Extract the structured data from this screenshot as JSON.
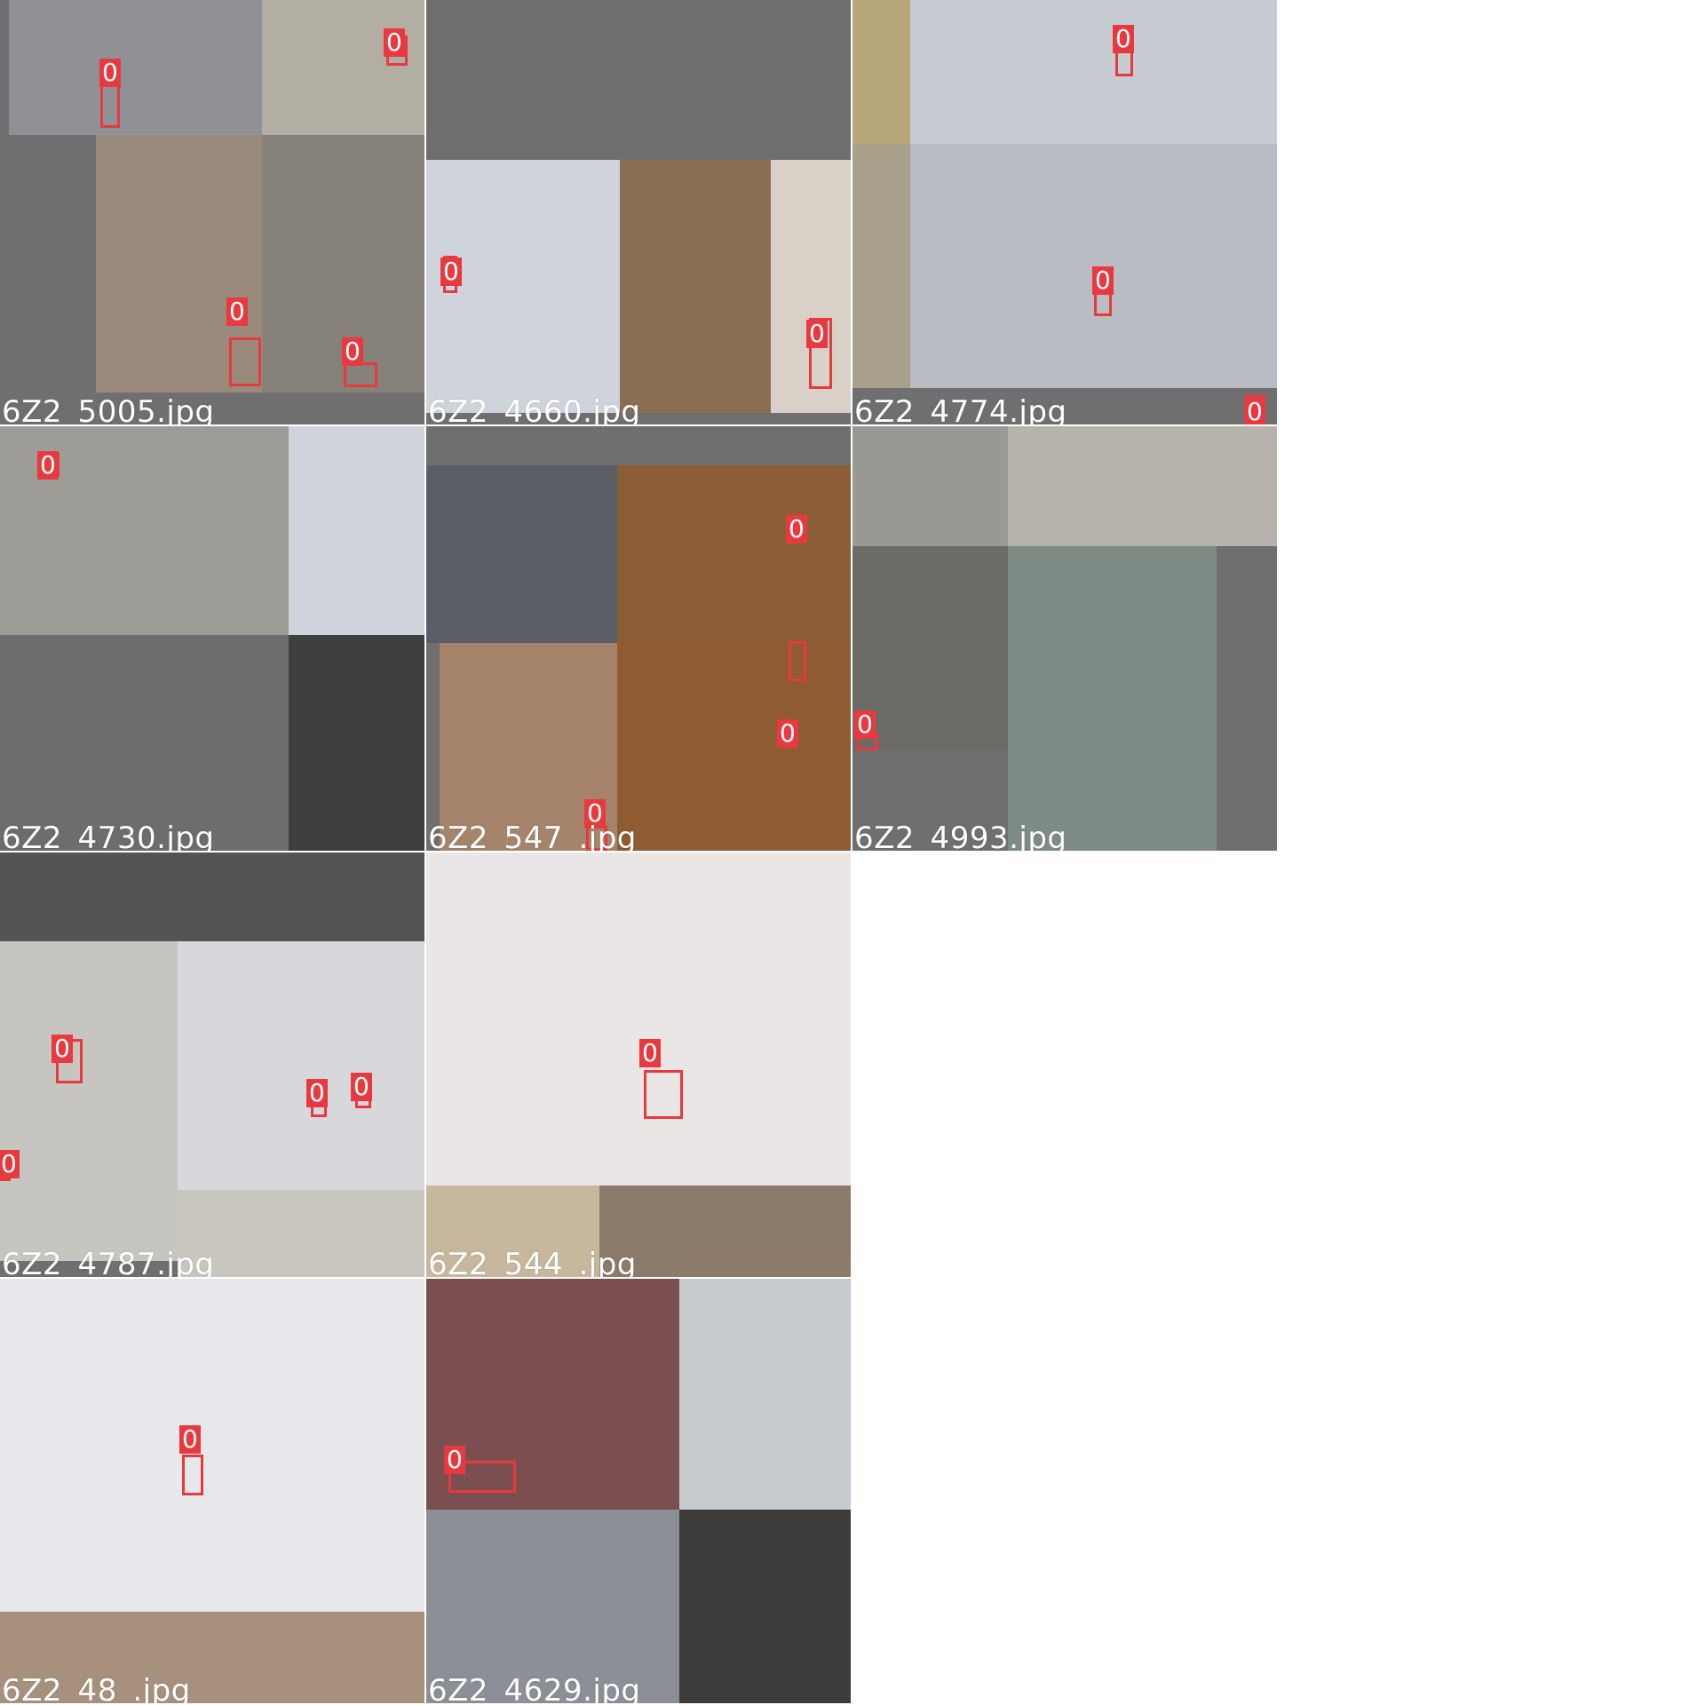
{
  "colors": {
    "box": "#e8393f",
    "tile_fill": "#6f6f70",
    "page_bg": "#ffffff",
    "caption": "#ffffff"
  },
  "tiles": [
    {
      "filename": "6Z2_5005.jpg",
      "detections": [
        "0",
        "0",
        "0",
        "0"
      ]
    },
    {
      "filename": "6Z2_4660.jpg",
      "detections": [
        "0",
        "0"
      ]
    },
    {
      "filename": "6Z2_4774.jpg",
      "detections": [
        "0",
        "0",
        "0"
      ]
    },
    {
      "filename": "6Z2_4730.jpg",
      "detections": [
        "0"
      ]
    },
    {
      "filename": "6Z2_547_.jpg",
      "detections": [
        "0",
        "0",
        "0"
      ]
    },
    {
      "filename": "6Z2_4993.jpg",
      "detections": [
        "0"
      ]
    },
    {
      "filename": "6Z2_4787.jpg",
      "detections": [
        "0",
        "0",
        "0",
        "0"
      ]
    },
    {
      "filename": "6Z2_544_.jpg",
      "detections": [
        "0"
      ]
    },
    {
      "filename": "6Z2_48_.jpg",
      "detections": [
        "0"
      ]
    },
    {
      "filename": "6Z2_4629.jpg",
      "detections": [
        "0"
      ]
    }
  ]
}
